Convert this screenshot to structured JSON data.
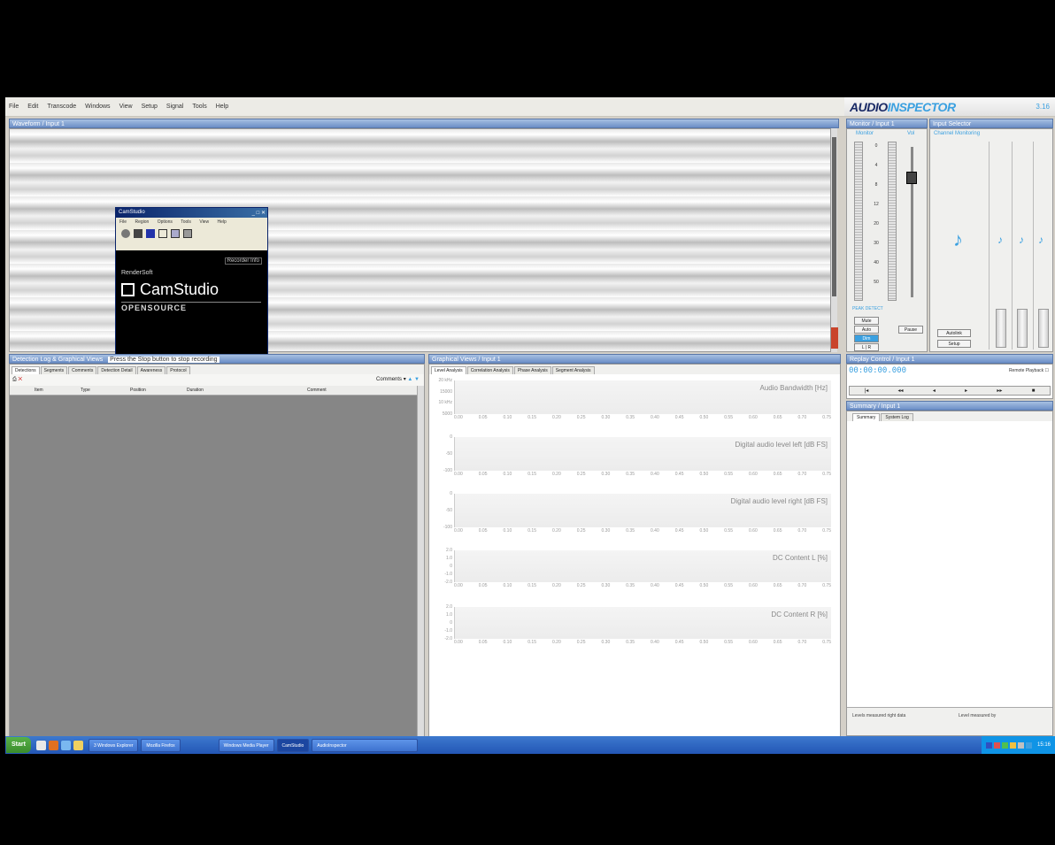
{
  "menu": [
    "File",
    "Edit",
    "Transcode",
    "Windows",
    "View",
    "Setup",
    "Signal",
    "Tools",
    "Help"
  ],
  "brand": {
    "logo_a": "AUDIO",
    "logo_b": "INSPECTOR",
    "version": "3.16"
  },
  "panels": {
    "waveform": "Waveform / Input 1",
    "monitor": "Monitor / Input 1",
    "selector": "Input Selector",
    "detection": "Detection Log & Graphical Views",
    "detection_hint": "Press the Stop button to stop recording",
    "graphical": "Graphical Views / Input 1",
    "replay": "Replay Control / Input 1",
    "summary": "Summary / Input 1"
  },
  "camstudio": {
    "title": "CamStudio",
    "menu": [
      "File",
      "Region",
      "Options",
      "Tools",
      "View",
      "Help"
    ],
    "link": "Recorder Info",
    "company": "RenderSoft",
    "name": "CamStudio",
    "edition": "OPENSOURCE"
  },
  "monitor": {
    "col_a": "Monitor",
    "col_b": "Vol",
    "scale": [
      "0",
      "4",
      "8",
      "12",
      "20",
      "30",
      "40",
      "50"
    ],
    "peak_label": "PEAK DETECT",
    "btn_mute": "Mute",
    "btn_auto": "Auto",
    "btn_dim": "Dim",
    "btn_pause": "Pause",
    "btn_lr": "L | R"
  },
  "selector": {
    "head": "Channel Monitoring",
    "btn_a": "Autolink",
    "btn_b": "Setup"
  },
  "detection": {
    "tabs": [
      "Detections",
      "Segments",
      "Comments",
      "Detection Detail",
      "Awareness",
      "Protocol"
    ],
    "toolbar_right": "Comments",
    "columns": [
      "Item",
      "Type",
      "Position",
      "Duration",
      "Comment"
    ]
  },
  "graph": {
    "tabs": [
      "Level Analysis",
      "Correlation Analysis",
      "Phase Analysis",
      "Segment Analysis"
    ],
    "plots": [
      {
        "title": "Audio Bandwidth [Hz]",
        "yticks": [
          "20 kHz",
          "15000",
          "10 kHz",
          "5000"
        ]
      },
      {
        "title": "Digital audio level left [dB FS]",
        "yticks": [
          "0",
          "-50",
          "-100"
        ]
      },
      {
        "title": "Digital audio level right [dB FS]",
        "yticks": [
          "0",
          "-50",
          "-100"
        ]
      },
      {
        "title": "DC Content L [%]",
        "yticks": [
          "2.0",
          "1.0",
          "0",
          "-1.0",
          "-2.0"
        ]
      },
      {
        "title": "DC Content R [%]",
        "yticks": [
          "2.0",
          "1.0",
          "0",
          "-1.0",
          "-2.0"
        ]
      }
    ],
    "xticks": [
      "0.00",
      "0.05",
      "0.10",
      "0.15",
      "0.20",
      "0.25",
      "0.30",
      "0.35",
      "0.40",
      "0.45",
      "0.50",
      "0.55",
      "0.60",
      "0.65",
      "0.70",
      "0.75"
    ]
  },
  "replay": {
    "time": "00:00:00.000",
    "option": "Remote Playback",
    "buttons": [
      "|◂",
      "◂◂",
      "◂",
      "▸",
      "▸▸",
      "■"
    ]
  },
  "summary": {
    "tabs": [
      "Summary",
      "System Log"
    ],
    "foot_left": "Levels measured right data",
    "foot_right": "Level measured by"
  },
  "taskbar": {
    "start": "Start",
    "tasks": [
      "3 Windows Explorer",
      "Mozilla Firefox",
      "Windows Media Player",
      "CamStudio",
      "AudioInspector"
    ],
    "clock": "15:16"
  }
}
